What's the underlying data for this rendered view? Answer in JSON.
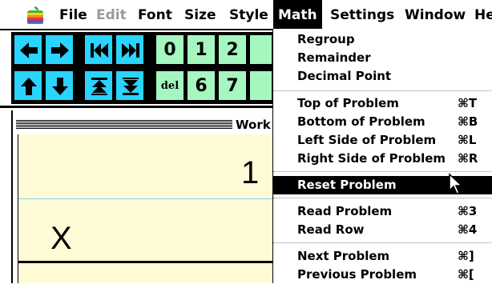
{
  "menubar": {
    "items": [
      {
        "label": "File",
        "state": "normal"
      },
      {
        "label": "Edit",
        "state": "disabled"
      },
      {
        "label": "Font",
        "state": "normal"
      },
      {
        "label": "Size",
        "state": "normal"
      },
      {
        "label": "Style",
        "state": "normal"
      },
      {
        "label": "Math",
        "state": "active"
      },
      {
        "label": "Settings",
        "state": "normal"
      },
      {
        "label": "Window",
        "state": "normal"
      },
      {
        "label": "He",
        "state": "normal"
      }
    ]
  },
  "palette": {
    "arrow_buttons": [
      "left-arrow-icon",
      "right-arrow-icon",
      "skip-back-icon",
      "skip-forward-icon",
      "up-arrow-icon",
      "down-arrow-icon",
      "move-top-icon",
      "move-bottom-icon"
    ],
    "digits_row1": [
      "0",
      "1",
      "2"
    ],
    "digits_row2": [
      "del",
      "6",
      "7"
    ],
    "colors": {
      "arrow_bg": "#2ad4ff",
      "digit_bg": "#a6f6bf"
    }
  },
  "worksheet": {
    "title": "Work",
    "top_digit": "1",
    "operator": "X",
    "paper_color": "#fffbd6"
  },
  "math_menu": {
    "groups": [
      [
        {
          "label": "Regroup",
          "shortcut": ""
        },
        {
          "label": "Remainder",
          "shortcut": ""
        },
        {
          "label": "Decimal Point",
          "shortcut": ""
        }
      ],
      [
        {
          "label": "Top of Problem",
          "shortcut": "⌘T"
        },
        {
          "label": "Bottom of Problem",
          "shortcut": "⌘B"
        },
        {
          "label": "Left Side of Problem",
          "shortcut": "⌘L"
        },
        {
          "label": "Right Side of Problem",
          "shortcut": "⌘R"
        }
      ],
      [
        {
          "label": "Reset Problem",
          "shortcut": "",
          "selected": true
        }
      ],
      [
        {
          "label": "Read Problem",
          "shortcut": "⌘3"
        },
        {
          "label": "Read Row",
          "shortcut": "⌘4"
        }
      ],
      [
        {
          "label": "Next Problem",
          "shortcut": "⌘]"
        },
        {
          "label": "Previous Problem",
          "shortcut": "⌘["
        }
      ]
    ]
  }
}
